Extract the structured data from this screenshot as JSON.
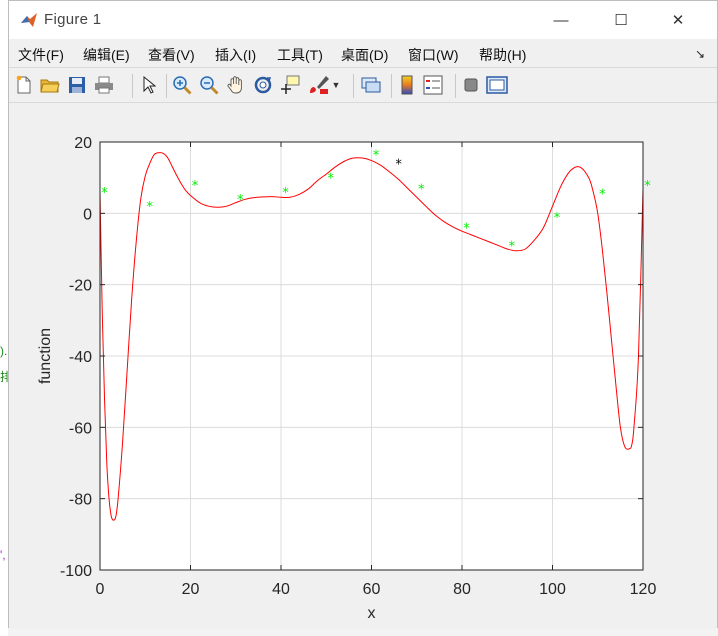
{
  "window": {
    "title": "Figure 1",
    "controls": {
      "minimize": "—",
      "maximize": "☐",
      "close": "✕"
    }
  },
  "menu": {
    "items": [
      "文件(F)",
      "编辑(E)",
      "查看(V)",
      "插入(I)",
      "工具(T)",
      "桌面(D)",
      "窗口(W)",
      "帮助(H)"
    ],
    "overflow_arrow": "↘"
  },
  "toolbar": {
    "buttons": [
      "new-figure-icon",
      "open-file-icon",
      "save-icon",
      "print-icon",
      "pointer-icon",
      "zoom-in-icon",
      "zoom-out-icon",
      "pan-hand-icon",
      "rotate-3d-icon",
      "data-cursor-icon",
      "brush-icon",
      "link-plot-icon",
      "colorbar-icon",
      "legend-icon",
      "hide-plot-tools-icon",
      "show-plot-tools-icon"
    ]
  },
  "side_peek": {
    "text1": ").",
    "text2": "排",
    "text3": "',"
  },
  "colors": {
    "curve": "#ff0000",
    "markers": "#00ee00",
    "extra_marker": "#000000",
    "grid": "#dcdcdc"
  },
  "chart_data": {
    "type": "line",
    "title": "",
    "xlabel": "x",
    "ylabel": "function",
    "xlim": [
      0,
      120
    ],
    "ylim": [
      -100,
      20
    ],
    "xticks": [
      "0",
      "20",
      "40",
      "60",
      "80",
      "100",
      "120"
    ],
    "yticks": [
      "20",
      "0",
      "-20",
      "-40",
      "-60",
      "-80",
      "-100"
    ],
    "grid": true,
    "series": [
      {
        "style": "line",
        "color": "#ff0000",
        "x": [
          0,
          0.5,
          1,
          1.5,
          2,
          2.5,
          3,
          3.5,
          4,
          5,
          6,
          7,
          8,
          9,
          10,
          11,
          12,
          13,
          14,
          15,
          16,
          17,
          18,
          19,
          20,
          22,
          24,
          26,
          28,
          30,
          32,
          34,
          36,
          38,
          40,
          42,
          44,
          46,
          48,
          50,
          52,
          54,
          56,
          58,
          60,
          62,
          64,
          66,
          68,
          70,
          72,
          74,
          76,
          78,
          80,
          82,
          84,
          86,
          88,
          90,
          92,
          94,
          96,
          98,
          100,
          102,
          104,
          106,
          108,
          109,
          110,
          111,
          112,
          113,
          114,
          115,
          116,
          117,
          117.5,
          118,
          119,
          120
        ],
        "y": [
          6,
          -28,
          -52,
          -70,
          -80,
          -85,
          -86,
          -85,
          -80,
          -64,
          -44,
          -24,
          -8,
          4,
          10.5,
          14,
          16.5,
          17,
          16.8,
          15.5,
          13,
          10.5,
          8.2,
          6.3,
          5,
          3,
          2,
          1.7,
          2,
          3,
          3.9,
          4.4,
          4.6,
          4.7,
          4.5,
          4.5,
          5.3,
          6.8,
          9.1,
          11,
          13,
          14.6,
          15.5,
          15.5,
          14.8,
          13.5,
          11.6,
          9.5,
          7,
          4.5,
          2,
          -0.4,
          -2.3,
          -3.8,
          -5,
          -6,
          -7,
          -8,
          -9,
          -10,
          -10.5,
          -10,
          -7.5,
          -4,
          2,
          8,
          12,
          13,
          10,
          6,
          0,
          -10,
          -22,
          -35,
          -48,
          -60,
          -65.5,
          -66,
          -65,
          -60,
          -40,
          7
        ]
      },
      {
        "style": "marker",
        "marker": "*",
        "color": "#00ee00",
        "x": [
          1,
          11,
          21,
          31,
          41,
          51,
          61,
          71,
          81,
          91,
          101,
          111,
          121
        ],
        "y": [
          6,
          2,
          8,
          4,
          6,
          10,
          16.5,
          7,
          -4,
          -9,
          -1,
          5.5,
          8
        ]
      },
      {
        "style": "marker",
        "marker": "*",
        "color": "#000000",
        "x": [
          66
        ],
        "y": [
          14
        ]
      }
    ]
  }
}
